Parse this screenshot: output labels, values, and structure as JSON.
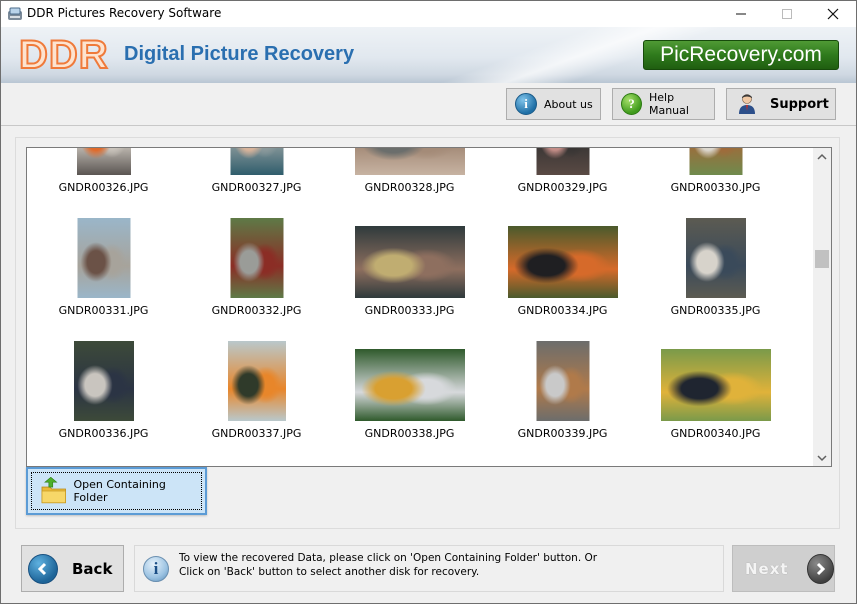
{
  "window": {
    "title": "DDR Pictures Recovery Software",
    "controls": {
      "minimize": "–",
      "maximize": "☐",
      "close": "✕"
    }
  },
  "banner": {
    "logo": "DDR",
    "title": "Digital Picture Recovery",
    "site": "PicRecovery.com"
  },
  "toolbar": {
    "about": "About us",
    "help": "Help Manual",
    "support": "Support"
  },
  "gallery": {
    "items": [
      {
        "name": "GNDR00326.JPG",
        "colors": [
          "#5a5552",
          "#e06a2a",
          "#c9c3bb"
        ]
      },
      {
        "name": "GNDR00327.JPG",
        "colors": [
          "#2f5d6c",
          "#d7b39a",
          "#8c9a9c"
        ]
      },
      {
        "name": "GNDR00328.JPG",
        "colors": [
          "#c7b3a2",
          "#6b6e6c",
          "#a48b78"
        ]
      },
      {
        "name": "GNDR00329.JPG",
        "colors": [
          "#5a4a44",
          "#c38d87",
          "#383534"
        ]
      },
      {
        "name": "GNDR00330.JPG",
        "colors": [
          "#6f8a4d",
          "#dcd8cf",
          "#a06a3a"
        ]
      },
      {
        "name": "GNDR00331.JPG",
        "colors": [
          "#9ab6c9",
          "#6b5247",
          "#a7a39b"
        ]
      },
      {
        "name": "GNDR00332.JPG",
        "colors": [
          "#5e7a47",
          "#9a9c98",
          "#8b2d25"
        ]
      },
      {
        "name": "GNDR00333.JPG",
        "colors": [
          "#2f3a3c",
          "#c0ad71",
          "#8e6f5f"
        ]
      },
      {
        "name": "GNDR00334.JPG",
        "colors": [
          "#4a5a2c",
          "#1f1f22",
          "#d66a2a"
        ]
      },
      {
        "name": "GNDR00335.JPG",
        "colors": [
          "#5c5b52",
          "#d7d3cb",
          "#3a4a5a"
        ]
      },
      {
        "name": "GNDR00336.JPG",
        "colors": [
          "#3d4a39",
          "#c9c5bf",
          "#2b3444"
        ]
      },
      {
        "name": "GNDR00337.JPG",
        "colors": [
          "#b9c8cb",
          "#2f3a2a",
          "#e8862a"
        ]
      },
      {
        "name": "GNDR00338.JPG",
        "colors": [
          "#2f5a2c",
          "#d9a031",
          "#d7d9dc"
        ]
      },
      {
        "name": "GNDR00339.JPG",
        "colors": [
          "#6c6d6c",
          "#c9c9c9",
          "#b07a4a"
        ]
      },
      {
        "name": "GNDR00340.JPG",
        "colors": [
          "#7a9a4a",
          "#1f2530",
          "#e0b23a"
        ]
      }
    ],
    "scroll_position": 0.4
  },
  "open_folder": {
    "label": "Open Containing Folder"
  },
  "footer": {
    "back": "Back",
    "info_line1": "To view the recovered Data, please click on 'Open Containing Folder' button. Or",
    "info_line2": "Click on 'Back' button to select another disk for recovery.",
    "next": "Next"
  }
}
